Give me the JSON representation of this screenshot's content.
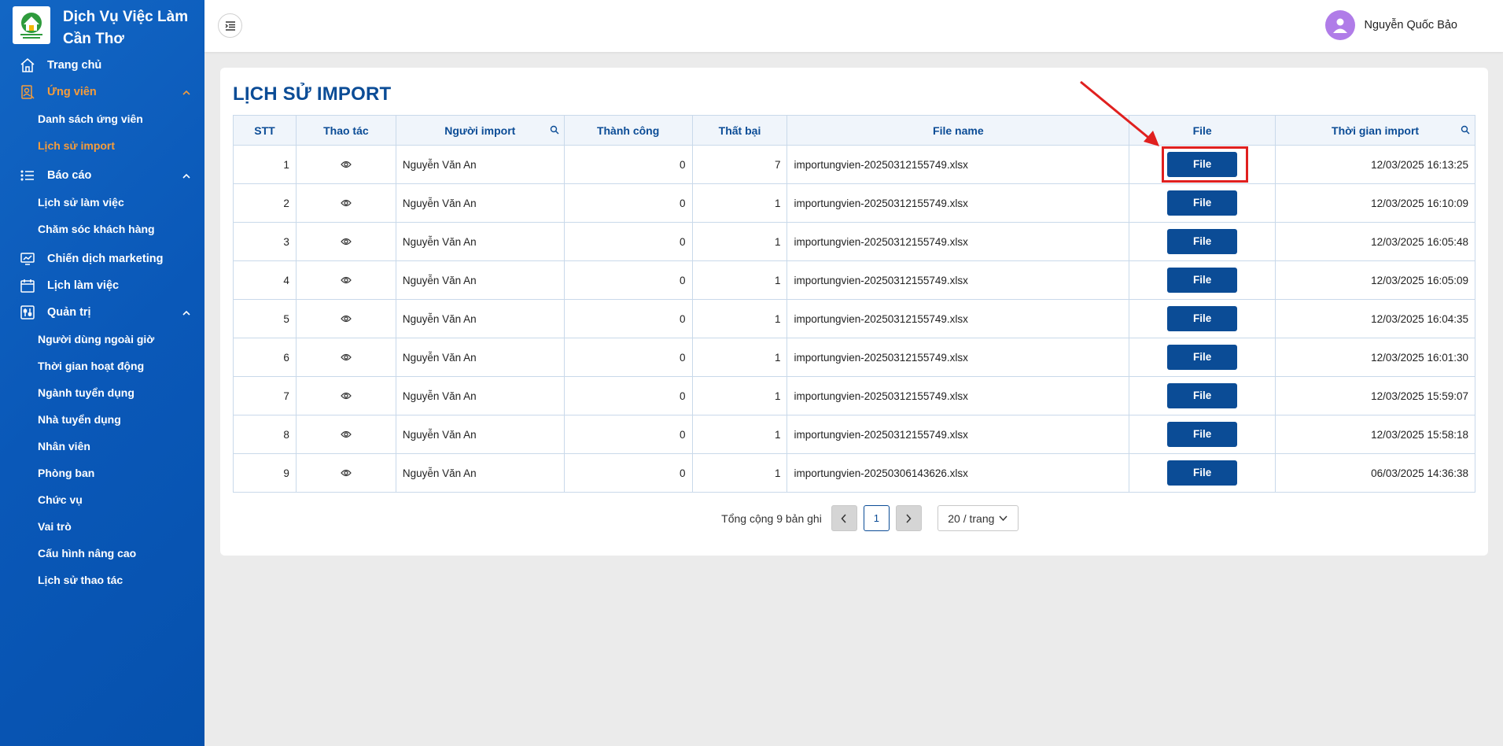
{
  "brand": {
    "line1": "Dịch Vụ Việc Làm",
    "line2": "Cần Thơ"
  },
  "sidebar": {
    "home": "Trang chủ",
    "candidates": "Ứng viên",
    "candidates_list": "Danh sách ứng viên",
    "import_history": "Lịch sử import",
    "reports": "Báo cáo",
    "work_history": "Lịch sử làm việc",
    "customer_care": "Chăm sóc khách hàng",
    "marketing": "Chiến dịch marketing",
    "schedule": "Lịch làm việc",
    "admin": "Quản trị",
    "admin_items": [
      "Người dùng ngoài giờ",
      "Thời gian hoạt động",
      "Ngành tuyển dụng",
      "Nhà tuyển dụng",
      "Nhân viên",
      "Phòng ban",
      "Chức vụ",
      "Vai trò",
      "Cấu hình nâng cao",
      "Lịch sử thao tác"
    ]
  },
  "user": {
    "name": "Nguyễn Quốc Bảo"
  },
  "page": {
    "title": "LỊCH SỬ IMPORT"
  },
  "table": {
    "headers": [
      "STT",
      "Thao tác",
      "Người import",
      "Thành công",
      "Thất bại",
      "File name",
      "File",
      "Thời gian import"
    ],
    "file_button": "File",
    "rows": [
      {
        "stt": "1",
        "user": "Nguyễn Văn An",
        "success": "0",
        "fail": "7",
        "filename": "importungvien-20250312155749.xlsx",
        "time": "12/03/2025 16:13:25"
      },
      {
        "stt": "2",
        "user": "Nguyễn Văn An",
        "success": "0",
        "fail": "1",
        "filename": "importungvien-20250312155749.xlsx",
        "time": "12/03/2025 16:10:09"
      },
      {
        "stt": "3",
        "user": "Nguyễn Văn An",
        "success": "0",
        "fail": "1",
        "filename": "importungvien-20250312155749.xlsx",
        "time": "12/03/2025 16:05:48"
      },
      {
        "stt": "4",
        "user": "Nguyễn Văn An",
        "success": "0",
        "fail": "1",
        "filename": "importungvien-20250312155749.xlsx",
        "time": "12/03/2025 16:05:09"
      },
      {
        "stt": "5",
        "user": "Nguyễn Văn An",
        "success": "0",
        "fail": "1",
        "filename": "importungvien-20250312155749.xlsx",
        "time": "12/03/2025 16:04:35"
      },
      {
        "stt": "6",
        "user": "Nguyễn Văn An",
        "success": "0",
        "fail": "1",
        "filename": "importungvien-20250312155749.xlsx",
        "time": "12/03/2025 16:01:30"
      },
      {
        "stt": "7",
        "user": "Nguyễn Văn An",
        "success": "0",
        "fail": "1",
        "filename": "importungvien-20250312155749.xlsx",
        "time": "12/03/2025 15:59:07"
      },
      {
        "stt": "8",
        "user": "Nguyễn Văn An",
        "success": "0",
        "fail": "1",
        "filename": "importungvien-20250312155749.xlsx",
        "time": "12/03/2025 15:58:18"
      },
      {
        "stt": "9",
        "user": "Nguyễn Văn An",
        "success": "0",
        "fail": "1",
        "filename": "importungvien-20250306143626.xlsx",
        "time": "06/03/2025 14:36:38"
      }
    ]
  },
  "pagination": {
    "total": "Tổng cộng 9 bản ghi",
    "current": "1",
    "page_size": "20 / trang"
  },
  "colors": {
    "primary": "#0b4c96",
    "sidebar": "#0a58b8",
    "active": "#f59c3b",
    "highlight": "#e0201f"
  }
}
